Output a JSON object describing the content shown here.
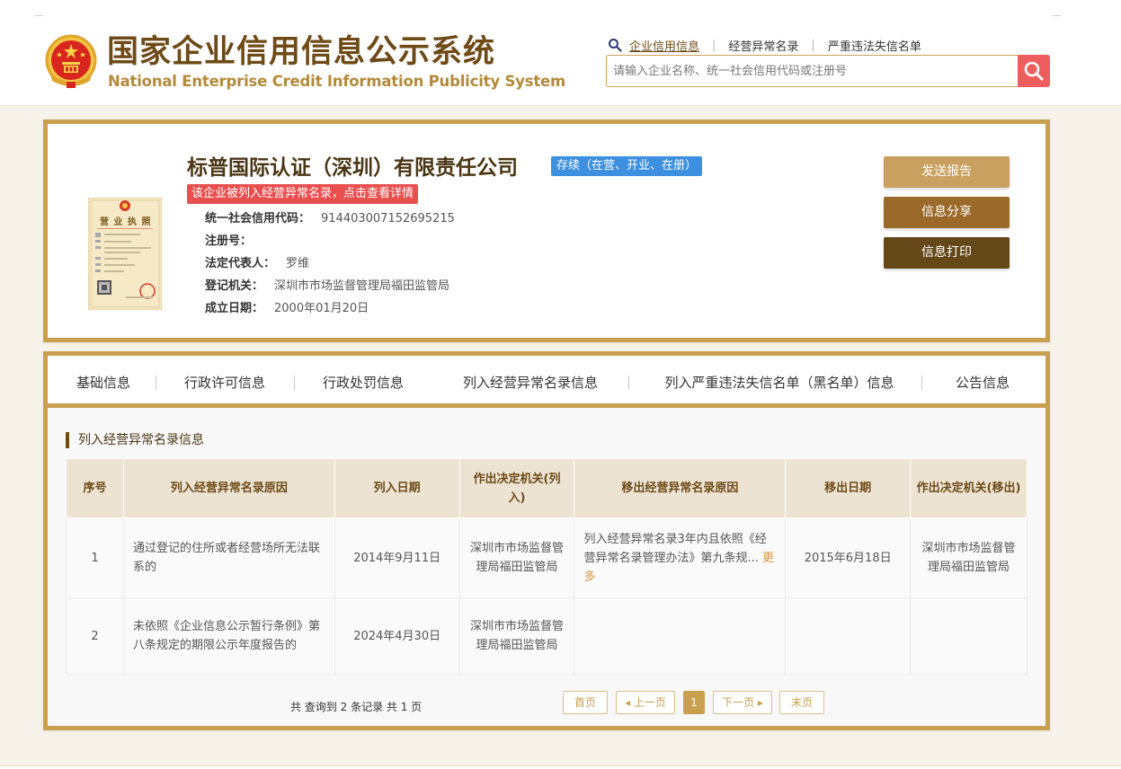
{
  "header": {
    "title_cn": "国家企业信用信息公示系统",
    "title_en": "National Enterprise Credit Information Publicity System",
    "top_links": [
      "企业信用信息",
      "经营异常名录",
      "严重违法失信名单"
    ],
    "search_placeholder": "请输入企业名称、统一社会信用代码或注册号",
    "icons": [
      "national-emblem-icon",
      "magnifier-icon",
      "search-icon"
    ]
  },
  "company": {
    "name": "标普国际认证（深圳）有限责任公司",
    "status": "存续（在营、开业、在册）",
    "alert": "该企业被列入经营异常名录，点击查看详情",
    "fields": [
      {
        "label": "统一社会信用代码：",
        "value": "914403007152695215"
      },
      {
        "label": "注册号：",
        "value": ""
      },
      {
        "label": "法定代表人：",
        "value": "罗维"
      },
      {
        "label": "登记机关：",
        "value": "深圳市市场监督管理局福田监管局"
      },
      {
        "label": "成立日期：",
        "value": "2000年01月20日"
      }
    ],
    "license_title": "营 业 执 照"
  },
  "actions": {
    "report": "发送报告",
    "share": "信息分享",
    "print": "信息打印"
  },
  "tabs": [
    "基础信息",
    "行政许可信息",
    "行政处罚信息",
    "列入经营异常名录信息",
    "列入严重违法失信名单（黑名单）信息",
    "公告信息"
  ],
  "section_title": "列入经营异常名录信息",
  "table": {
    "headers": [
      "序号",
      "列入经营异常名录原因",
      "列入日期",
      "作出决定机关(列入)",
      "移出经营异常名录原因",
      "移出日期",
      "作出决定机关(移出)"
    ],
    "rows": [
      {
        "no": "1",
        "reason_in": "通过登记的住所或者经营场所无法联系的",
        "date_in": "2014年9月11日",
        "authority_in": "深圳市市场监督管理局福田监管局",
        "reason_out": "列入经营异常名录3年内且依照《经营异常名录管理办法》第九条规...",
        "more": "更多",
        "date_out": "2015年6月18日",
        "authority_out": "深圳市市场监督管理局福田监管局"
      },
      {
        "no": "2",
        "reason_in": "未依照《企业信息公示暂行条例》第八条规定的期限公示年度报告的",
        "date_in": "2024年4月30日",
        "authority_in": "深圳市市场监督管理局福田监管局",
        "reason_out": "",
        "more": "",
        "date_out": "",
        "authority_out": ""
      }
    ]
  },
  "pager": {
    "summary": "共 查询到 2 条记录 共 1 页",
    "first": "首页",
    "prev": "◂ 上一页",
    "current": "1",
    "next": "下一页 ▸",
    "last": "末页"
  },
  "colors": {
    "brand_brown": "#6e4a17",
    "gold_border": "#c8a04f",
    "status_blue": "#3d8fe0",
    "alert_red": "#e94f4f",
    "active_tab": "#f06a6a"
  }
}
